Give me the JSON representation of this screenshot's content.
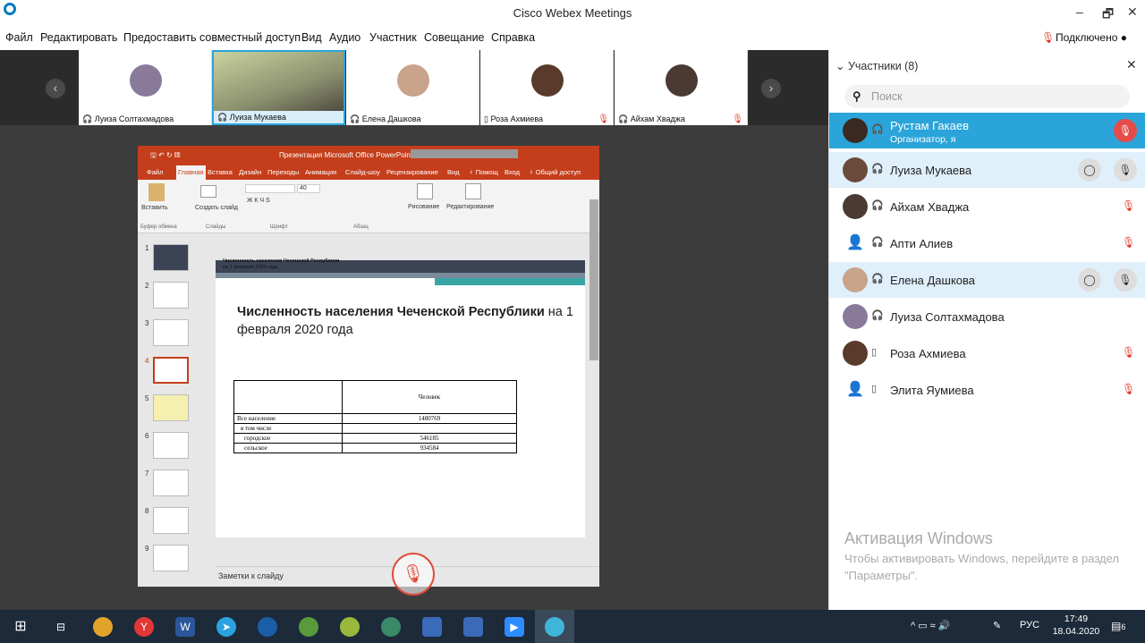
{
  "window": {
    "title": "Cisco Webex Meetings",
    "minimize": "–",
    "restore": "🗗",
    "close": "✕"
  },
  "menu": [
    "Файл",
    "Редактировать",
    "Предоставить совместный доступ",
    "Вид",
    "Аудио",
    "Участник",
    "Совещание",
    "Справка"
  ],
  "status": {
    "mic": "🎙",
    "text": "Подключено ●"
  },
  "strip": {
    "prev": "‹",
    "next": "›",
    "tiles": [
      {
        "name": "Луиза Солтахмадова",
        "audio": "🎧",
        "mute": ""
      },
      {
        "name": "Луиза Мукаева",
        "audio": "🎧",
        "mute": ""
      },
      {
        "name": "Елена Дашкова",
        "audio": "🎧",
        "mute": ""
      },
      {
        "name": "Роза Ахмиева",
        "audio": "▯",
        "mute": "🎙"
      },
      {
        "name": "Айхам Хваджа",
        "audio": "🎧",
        "mute": "🎙"
      }
    ]
  },
  "powerpoint": {
    "title": "Презентация Microsoft Office PowerPoint",
    "qa": "🖫 ↶ ↻ ▦",
    "tabs": [
      "Файл",
      "Главная",
      "Вставка",
      "Дизайн",
      "Переходы",
      "Анимация",
      "Слайд-шоу",
      "Рецензирование",
      "Вид",
      "♀ Помощ",
      "Вход",
      "♀ Общий доступ"
    ],
    "ribbon": {
      "paste": "Вставить",
      "create": "Создать слайд",
      "draw": "Рисование",
      "edit": "Редактирование",
      "font_size": "40",
      "groups": [
        "Буфер обмена",
        "Слайды",
        "Шрифт",
        "Абзац"
      ]
    },
    "thumb_numbers": [
      "1",
      "2",
      "3",
      "4",
      "5",
      "6",
      "7",
      "8",
      "9"
    ],
    "slide": {
      "small_title": "Численность населения Чеченской Республики",
      "small_sub": "на 1 февраля 2020 года",
      "heading_bold": "Численность населения Чеченской Республики",
      "heading_rest": " на 1 февраля 2020 года",
      "table": {
        "header": [
          "",
          "Человек"
        ],
        "rows": [
          [
            "Все население",
            "1480769"
          ],
          [
            "в том числе",
            ""
          ],
          [
            "городское",
            "546185"
          ],
          [
            "сельское",
            "934584"
          ]
        ]
      }
    },
    "notes": "Заметки к слайду"
  },
  "panel": {
    "title": "Участники (8)",
    "close": "✕",
    "search_placeholder": "Поиск",
    "participants": [
      {
        "name": "Рустам Гакаев",
        "role": "Организатор, я",
        "audio": "🎧"
      },
      {
        "name": "Луиза Мукаева",
        "audio": "🎧"
      },
      {
        "name": "Айхам Хваджа",
        "audio": "🎧"
      },
      {
        "name": "Апти Алиев",
        "audio": "🎧"
      },
      {
        "name": "Елена Дашкова",
        "audio": "🎧"
      },
      {
        "name": "Луиза Солтахмадова",
        "audio": "🎧"
      },
      {
        "name": "Роза Ахмиева",
        "audio": "▯"
      },
      {
        "name": "Элита Яумиева",
        "audio": "▯"
      }
    ]
  },
  "watermark": {
    "title": "Активация Windows",
    "text": "Чтобы активировать Windows, перейдите в раздел \"Параметры\"."
  },
  "taskbar": {
    "lang": "РУС",
    "time": "17:49",
    "date": "18.04.2020",
    "notif": "6",
    "tray": "^ ▭ ≈ 🔊"
  }
}
